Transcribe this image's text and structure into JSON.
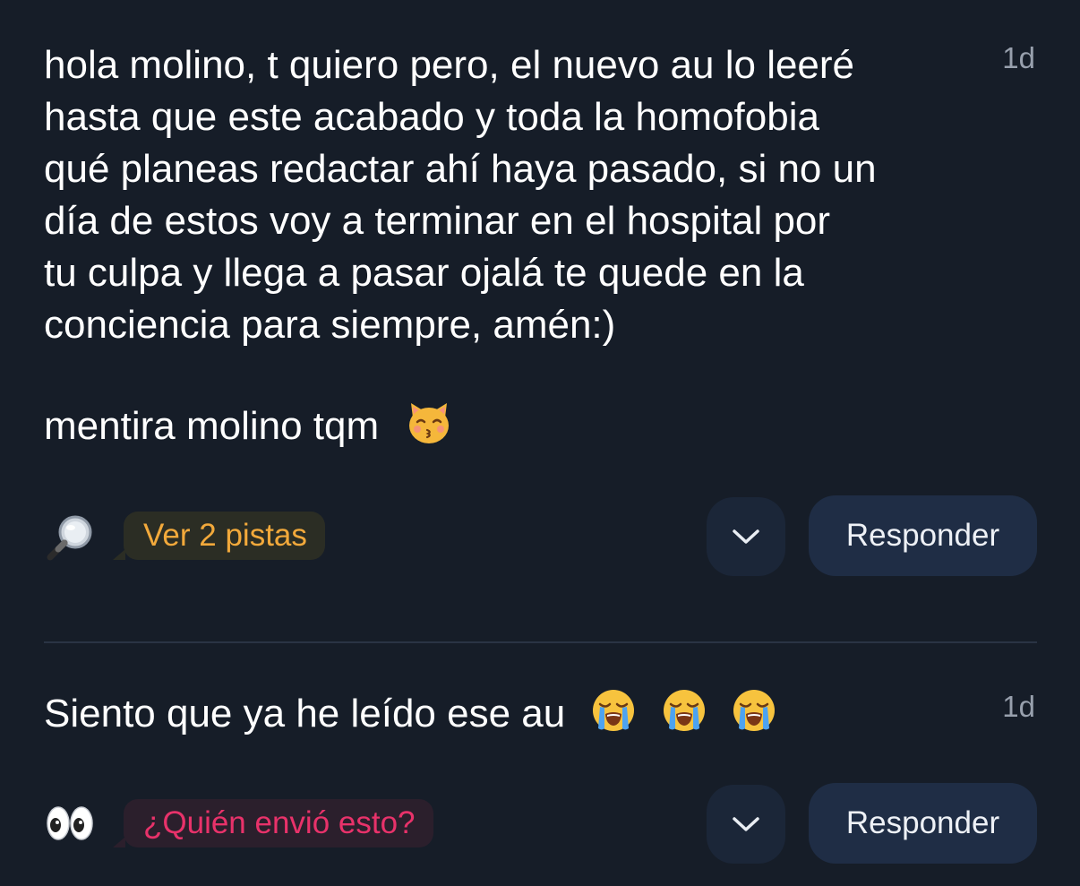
{
  "messages": [
    {
      "lines": [
        "hola molino, t quiero pero, el nuevo au lo leeré",
        "hasta que este acabado y toda la homofobia",
        "qué planeas redactar ahí haya pasado, si no un",
        "día de estos voy a terminar en el hospital por",
        "tu culpa y llega a pasar ojalá te quede en la",
        "conciencia para siempre, amén:)"
      ],
      "second_paragraph": "mentira molino tqm",
      "trailing_emoji": "kissing-cat-face",
      "timestamp": "1d",
      "hint_icon": "magnifying-glass-icon",
      "hint_label": "Ver 2 pistas",
      "hint_color": "#f2a93b",
      "reply_label": "Responder"
    },
    {
      "text": "Siento que ya he leído ese au",
      "trailing_emojis": [
        "loudly-crying-face",
        "loudly-crying-face",
        "loudly-crying-face"
      ],
      "timestamp": "1d",
      "hint_icon": "eyes-icon",
      "hint_label": "¿Quién envió esto?",
      "hint_color": "#e8326a",
      "reply_label": "Responder"
    }
  ],
  "colors": {
    "background": "#161d28",
    "reply_button": "#1f2d45",
    "chevron_button": "#1b2638",
    "divider": "#2a3444",
    "timestamp": "#98a0ad"
  }
}
